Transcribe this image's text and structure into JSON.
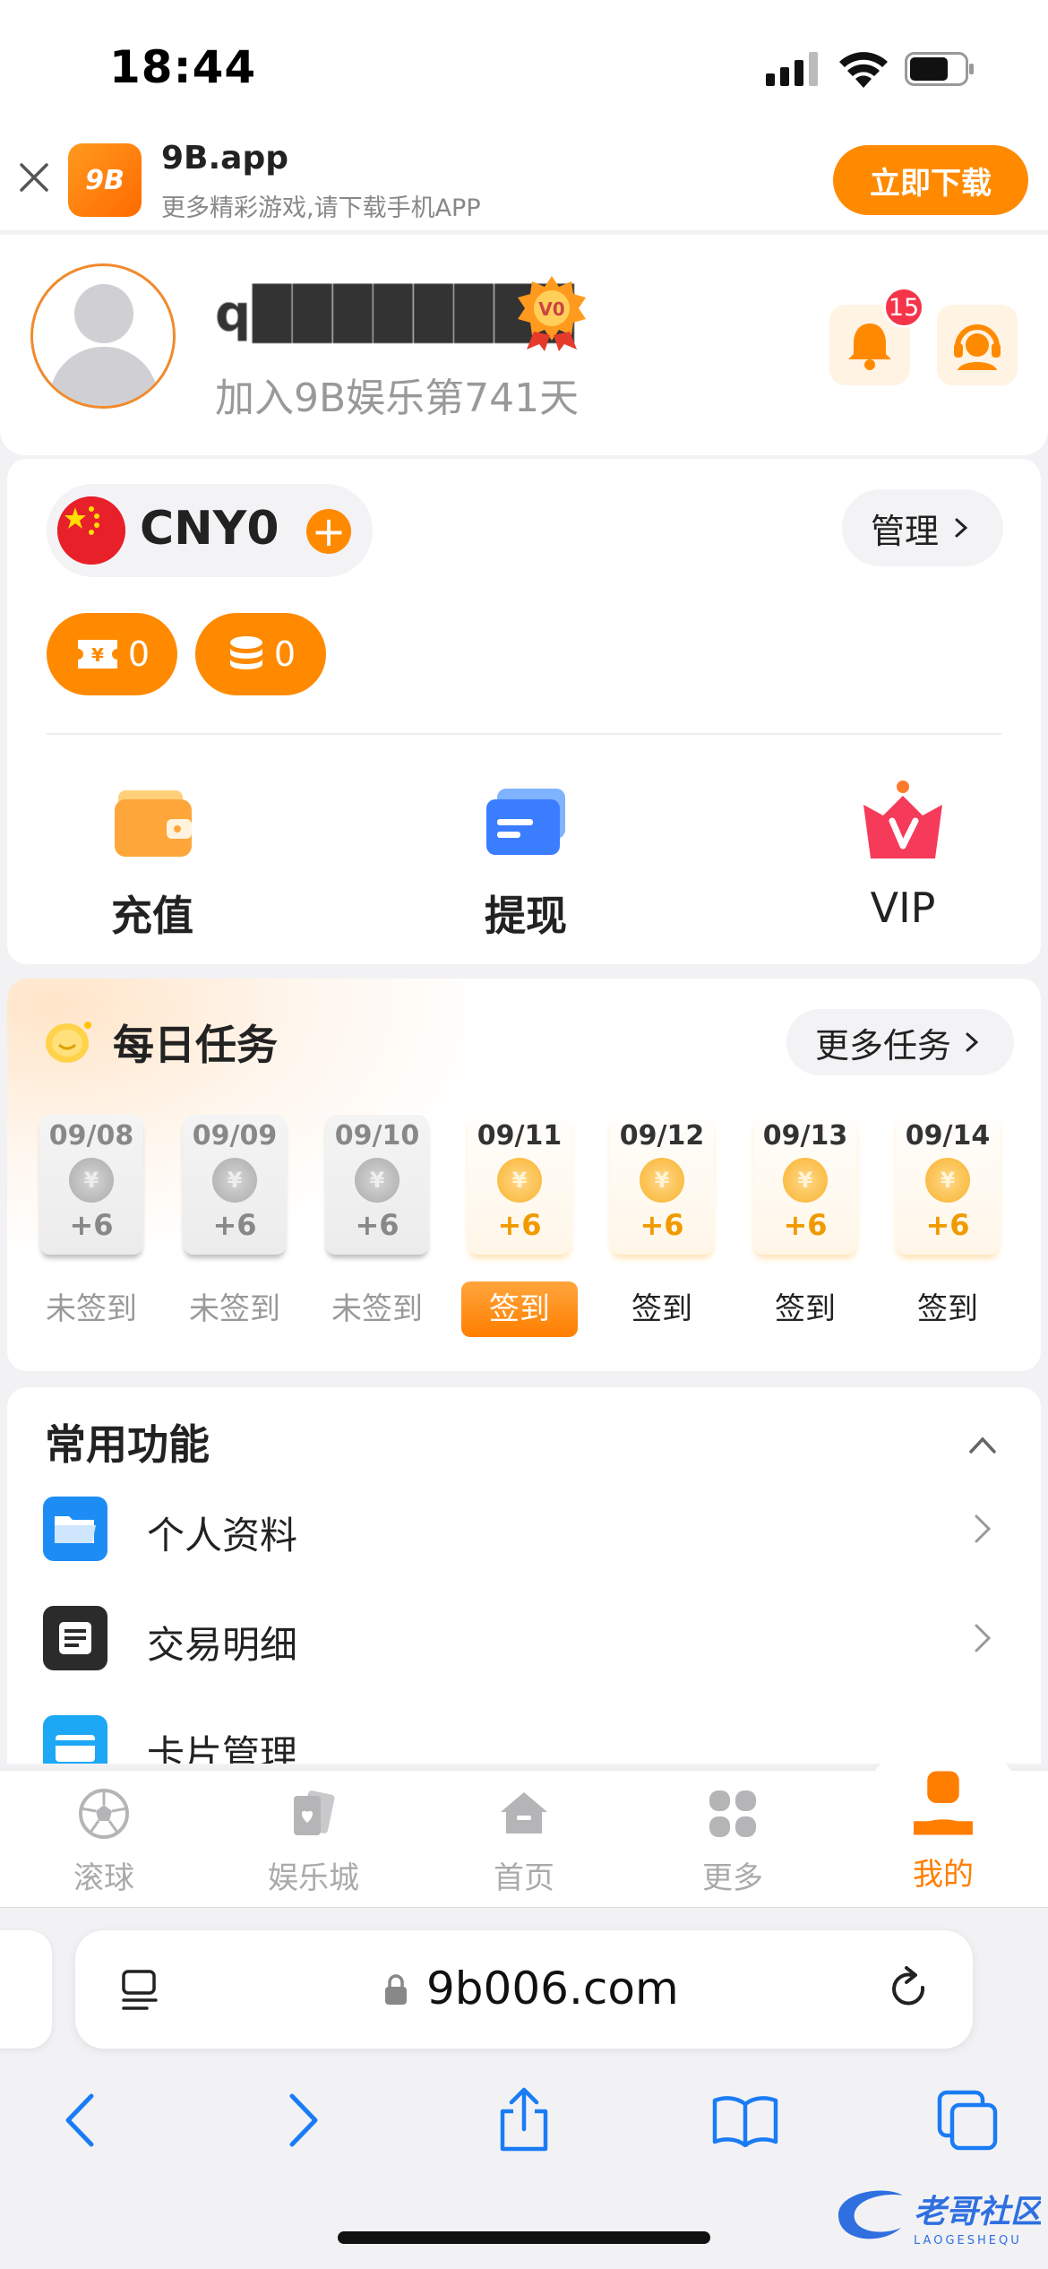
{
  "status_bar": {
    "time": "18:44"
  },
  "app_banner": {
    "logo_text": "9B",
    "app_name": "9B.app",
    "subtitle": "更多精彩游戏,请下载手机APP",
    "download_label": "立即下载"
  },
  "profile": {
    "username": "q████████",
    "vip_badge": "V0",
    "join_days": "加入9B娱乐第741天",
    "notification_count": "15"
  },
  "wallet": {
    "currency": "CNY",
    "balance": "0",
    "manage_label": "管理",
    "coupon_count": "0",
    "points_count": "0",
    "actions": [
      {
        "label": "充值",
        "icon": "wallet-icon"
      },
      {
        "label": "提现",
        "icon": "card-icon"
      },
      {
        "label": "VIP",
        "icon": "crown-icon"
      }
    ]
  },
  "daily_tasks": {
    "title": "每日任务",
    "more_label": "更多任务",
    "days": [
      {
        "date": "09/08",
        "reward": "+6",
        "status": "未签到",
        "state": "unsigned"
      },
      {
        "date": "09/09",
        "reward": "+6",
        "status": "未签到",
        "state": "unsigned"
      },
      {
        "date": "09/10",
        "reward": "+6",
        "status": "未签到",
        "state": "unsigned"
      },
      {
        "date": "09/11",
        "reward": "+6",
        "status": "签到",
        "state": "today"
      },
      {
        "date": "09/12",
        "reward": "+6",
        "status": "签到",
        "state": "signed"
      },
      {
        "date": "09/13",
        "reward": "+6",
        "status": "签到",
        "state": "signed"
      },
      {
        "date": "09/14",
        "reward": "+6",
        "status": "签到",
        "state": "signed"
      }
    ]
  },
  "functions": {
    "title": "常用功能",
    "items": [
      {
        "label": "个人资料",
        "icon": "folder-icon"
      },
      {
        "label": "交易明细",
        "icon": "document-icon"
      },
      {
        "label": "卡片管理",
        "icon": "card-icon"
      }
    ]
  },
  "tab_bar": {
    "tabs": [
      {
        "label": "滚球",
        "icon": "soccer-ball-icon"
      },
      {
        "label": "娱乐城",
        "icon": "cards-icon"
      },
      {
        "label": "首页",
        "icon": "home-icon"
      },
      {
        "label": "更多",
        "icon": "grid-icon"
      },
      {
        "label": "我的",
        "icon": "user-icon"
      }
    ],
    "active_index": 4
  },
  "browser": {
    "url": "9b006.com"
  },
  "colors": {
    "accent": "#ff8a00",
    "badge_red": "#f5344a",
    "signed_gold": "#f9b22b"
  }
}
